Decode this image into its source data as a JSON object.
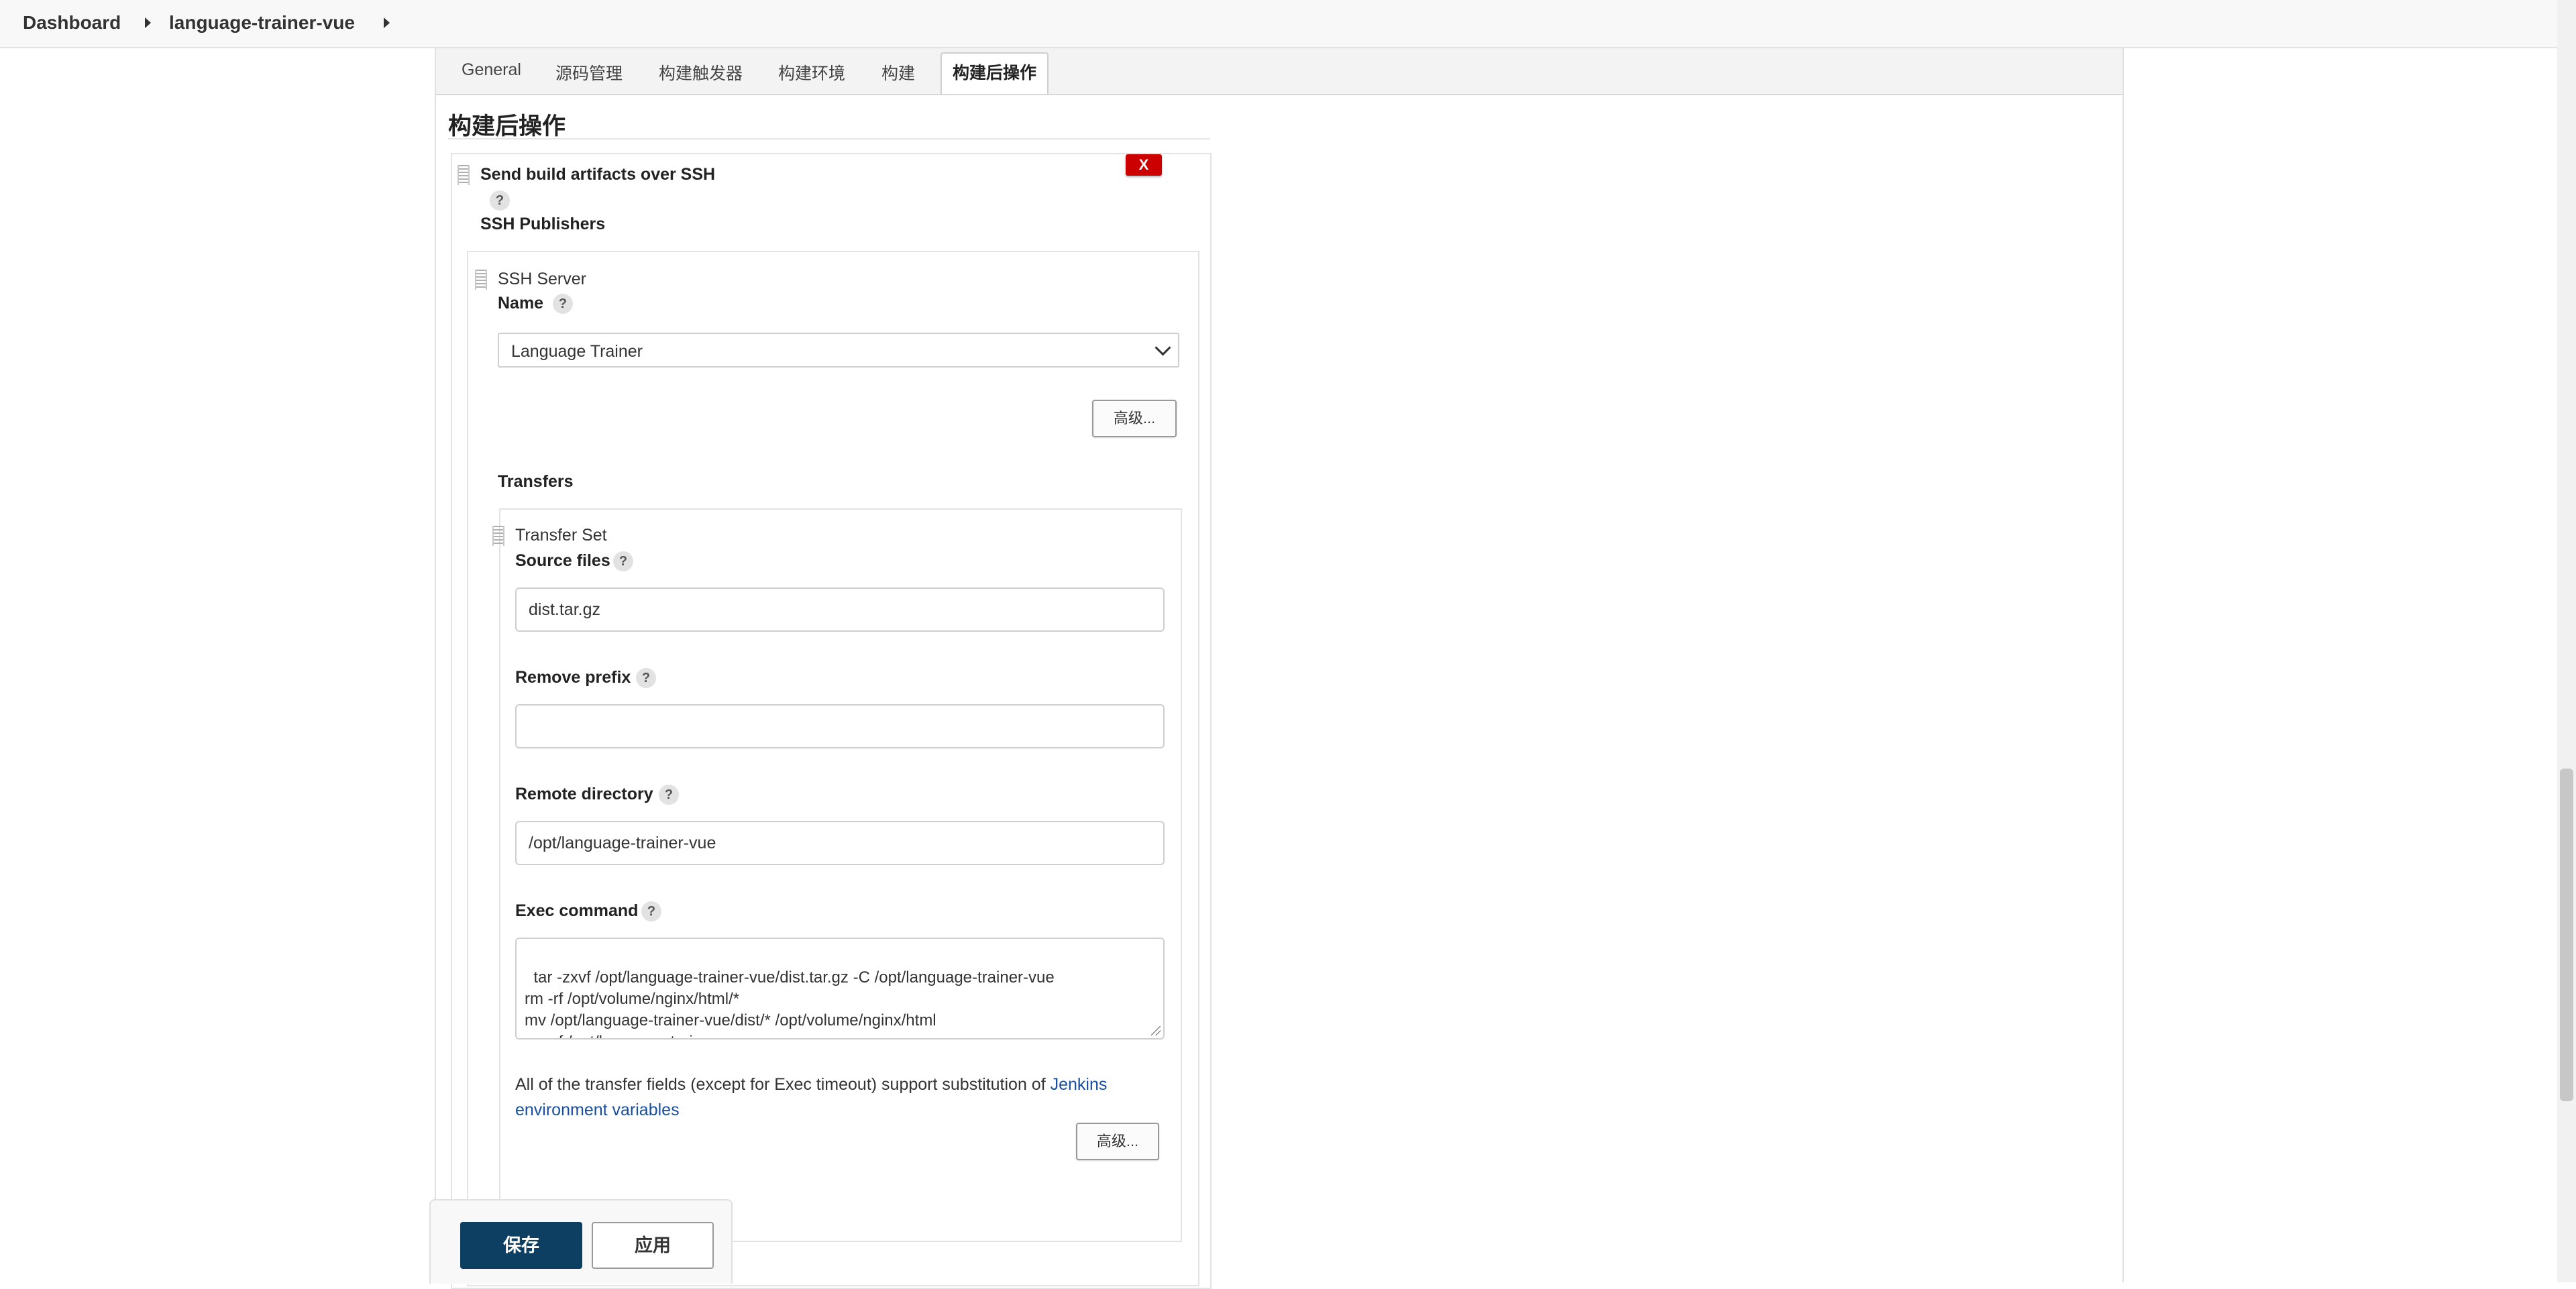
{
  "breadcrumb": {
    "items": [
      "Dashboard",
      "language-trainer-vue"
    ]
  },
  "tabs": [
    "General",
    "源码管理",
    "构建触发器",
    "构建环境",
    "构建",
    "构建后操作"
  ],
  "active_tab": "构建后操作",
  "section_title": "构建后操作",
  "publisher": {
    "title": "Send build artifacts over SSH",
    "delete_label": "X",
    "ssh_publishers_label": "SSH Publishers",
    "ssh_server": {
      "header": "SSH Server",
      "name_label": "Name",
      "name_value": "Language Trainer",
      "advanced_label": "高级..."
    },
    "transfers_label": "Transfers",
    "transfer_set": {
      "header": "Transfer Set",
      "source_files_label": "Source files",
      "source_files_value": "dist.tar.gz",
      "remove_prefix_label": "Remove prefix",
      "remove_prefix_value": "",
      "remote_directory_label": "Remote directory",
      "remote_directory_value": "/opt/language-trainer-vue",
      "exec_command_label": "Exec command",
      "exec_command_value": "tar -zxvf /opt/language-trainer-vue/dist.tar.gz -C /opt/language-trainer-vue\nrm -rf /opt/volume/nginx/html/*\nmv /opt/language-trainer-vue/dist/* /opt/volume/nginx/html\nrm -rf /opt/language-trainer-vue",
      "info_text": "All of the transfer fields (except for Exec timeout) support substitution of ",
      "info_link": "Jenkins environment variables",
      "advanced_label": "高级..."
    }
  },
  "help_symbol": "?",
  "actions": {
    "save_label": "保存",
    "apply_label": "应用"
  },
  "colors": {
    "primary": "#0d3f63",
    "danger": "#cc0000",
    "link": "#1a4fa0"
  }
}
